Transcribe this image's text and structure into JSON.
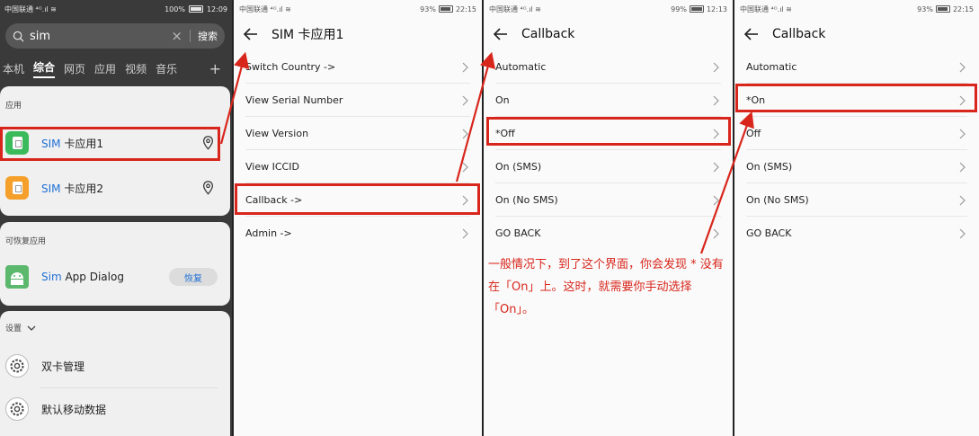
{
  "panel1": {
    "status": {
      "carrier": "中国联通 ⁴ᴳ.ıl ≋",
      "battery": "100%",
      "time": "12:09"
    },
    "search": {
      "query": "sim",
      "button": "搜索"
    },
    "categories": [
      "本机",
      "综合",
      "网页",
      "应用",
      "视频",
      "音乐"
    ],
    "apps_section": {
      "title": "应用",
      "items": [
        {
          "highlight": "SIM",
          "rest": " 卡应用1"
        },
        {
          "highlight": "SIM",
          "rest": " 卡应用2"
        }
      ]
    },
    "recoverable_section": {
      "title": "可恢复应用",
      "app": {
        "highlight": "Sim",
        "rest": " App Dialog"
      },
      "restore_label": "恢复"
    },
    "settings_section": {
      "title": "设置",
      "items": [
        "双卡管理",
        "默认移动数据"
      ]
    }
  },
  "panel2": {
    "status": {
      "carrier": "中国联通 ⁴ᴳ.ıl ≋",
      "battery": "93%",
      "time": "22:15"
    },
    "title": "SIM 卡应用1",
    "items": [
      "Switch Country ->",
      "View Serial Number",
      "View Version",
      "View ICCID",
      "Callback ->",
      "Admin ->"
    ]
  },
  "panel3": {
    "status": {
      "carrier": "中国联通 ⁴ᴳ.ıl ≋",
      "battery": "99%",
      "time": "12:13"
    },
    "title": "Callback",
    "items": [
      "Automatic",
      "On",
      "*Off",
      "On (SMS)",
      "On (No SMS)",
      "GO BACK"
    ],
    "note": "一般情况下，到了这个界面，你会发现 * 没有在「On」上。这时，就需要你手动选择「On」。"
  },
  "panel4": {
    "status": {
      "carrier": "中国联通 ⁴ᴳ.ıl ≋",
      "battery": "93%",
      "time": "22:15"
    },
    "title": "Callback",
    "items": [
      "Automatic",
      "*On",
      "Off",
      "On (SMS)",
      "On (No SMS)",
      "GO BACK"
    ]
  },
  "colors": {
    "annotation": "#d8261c",
    "link_blue": "#1f6fd6",
    "dark_bg": "#3a3a3a"
  },
  "icons": [
    "search-icon",
    "clear-icon",
    "plus-icon",
    "sim-app-icon",
    "location-pin-icon",
    "android-icon",
    "settings-gear-icon",
    "chevron-down-icon",
    "back-arrow-icon",
    "chevron-right-icon"
  ]
}
